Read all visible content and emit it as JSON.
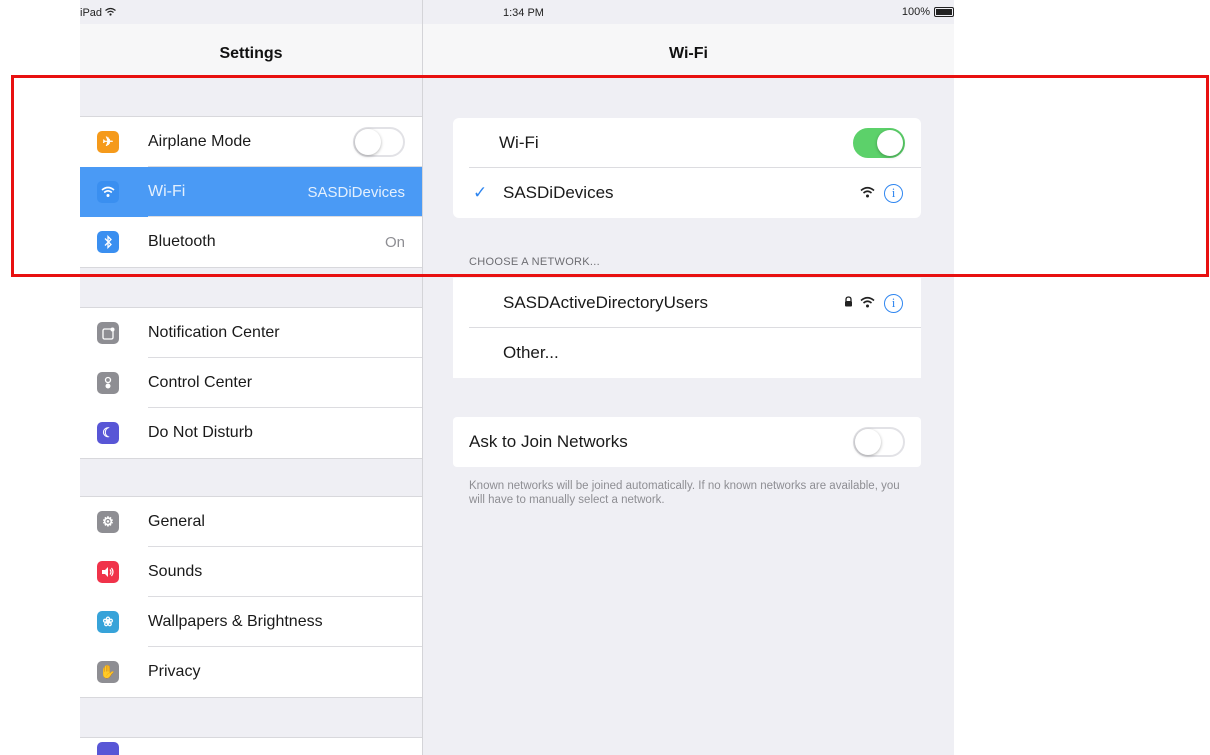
{
  "status_bar": {
    "device": "iPad",
    "time": "1:34 PM",
    "battery": "100%"
  },
  "left_pane": {
    "title": "Settings",
    "groups": [
      [
        {
          "label": "Airplane Mode",
          "icon": "airplane-icon",
          "color": "#f59a1b",
          "toggle": "off"
        },
        {
          "label": "Wi-Fi",
          "value": "SASDiDevices",
          "icon": "wifi-icon",
          "color": "#3a8ff0",
          "selected": true
        },
        {
          "label": "Bluetooth",
          "value": "On",
          "icon": "bluetooth-icon",
          "color": "#3a8ff0"
        }
      ],
      [
        {
          "label": "Notification Center",
          "icon": "notification-center-icon",
          "color": "#8e8e93"
        },
        {
          "label": "Control Center",
          "icon": "control-center-icon",
          "color": "#8e8e93"
        },
        {
          "label": "Do Not Disturb",
          "icon": "moon-icon",
          "color": "#5856d6"
        }
      ],
      [
        {
          "label": "General",
          "icon": "gear-icon",
          "color": "#8e8e93"
        },
        {
          "label": "Sounds",
          "icon": "speaker-icon",
          "color": "#f0334a"
        },
        {
          "label": "Wallpapers & Brightness",
          "icon": "flower-icon",
          "color": "#37a3d9"
        },
        {
          "label": "Privacy",
          "icon": "hand-icon",
          "color": "#8e8e93"
        }
      ]
    ]
  },
  "right_pane": {
    "title": "Wi-Fi",
    "wifi_toggle_label": "Wi-Fi",
    "wifi_enabled": "on",
    "connected_network": "SASDiDevices",
    "choose_header": "CHOOSE A NETWORK...",
    "networks": [
      {
        "name": "SASDActiveDirectoryUsers",
        "secured": true
      },
      {
        "name": "Other..."
      }
    ],
    "ask_to_join_label": "Ask to Join Networks",
    "ask_to_join": "off",
    "ask_to_join_footer": "Known networks will be joined automatically. If no known networks are available, you will have to manually select a network."
  },
  "colors": {
    "accent": "#2f86f0",
    "toggle_on": "#5cd16a",
    "highlight": "#e81010",
    "selected_row": "#4a9af5"
  }
}
